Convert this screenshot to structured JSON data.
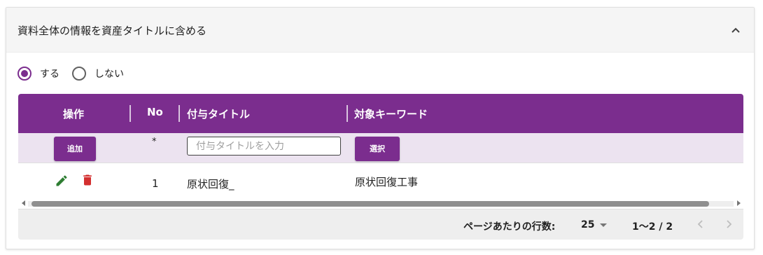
{
  "panel": {
    "title": "資料全体の情報を資産タイトルに含める",
    "collapse_icon": "chevron-up-icon"
  },
  "options": [
    {
      "label": "する",
      "checked": true
    },
    {
      "label": "しない",
      "checked": false
    }
  ],
  "table": {
    "headers": [
      "操作",
      "No",
      "付与タイトル",
      "対象キーワード"
    ],
    "input_row": {
      "add_label": "追加",
      "no_marker": "*",
      "title_placeholder": "付与タイトルを入力",
      "select_label": "選択"
    },
    "rows": [
      {
        "no": "1",
        "title": "原状回復_",
        "keyword": "原状回復工事"
      }
    ],
    "row_icons": [
      "edit-icon",
      "delete-icon"
    ]
  },
  "pagination": {
    "rows_per_page_label": "ページあたりの行数:",
    "rows_per_page": "25",
    "range": "1〜2 / 2"
  },
  "colors": {
    "accent": "#7b2d8e",
    "input_row_bg": "#ece3f0",
    "edit": "#2e7d32",
    "delete": "#d32f2f"
  }
}
